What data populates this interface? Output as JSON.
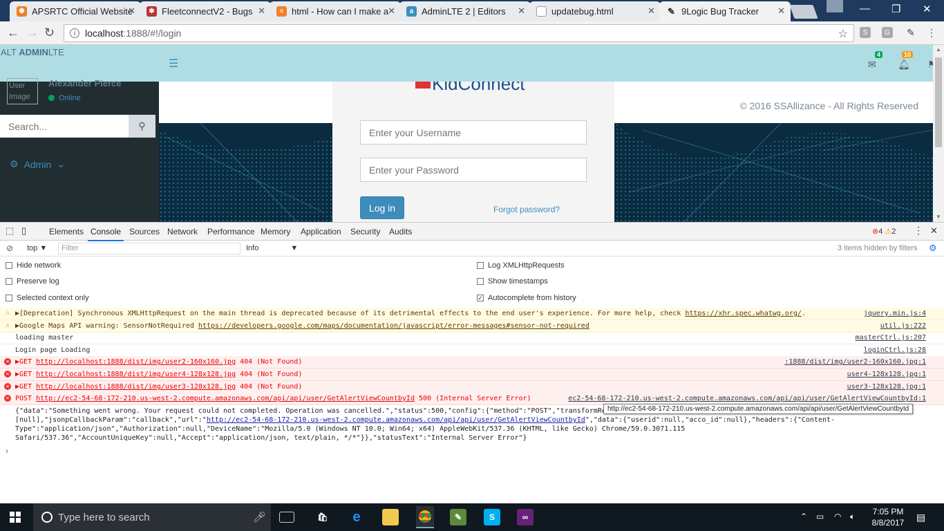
{
  "browser": {
    "tabs": [
      {
        "title": "APSRTC Official Website"
      },
      {
        "title": "FleetconnectV2 - Bugs"
      },
      {
        "title": "html - How can I make a"
      },
      {
        "title": "AdminLTE 2 | Editors"
      },
      {
        "title": "updatebug.html"
      },
      {
        "title": "9Logic Bug Tracker"
      }
    ],
    "url_host": "localhost",
    "url_path": ":1888/#!/login"
  },
  "app": {
    "brand_prefix": "ALT ",
    "brand_bold": "ADMIN",
    "brand_suffix": "LTE",
    "mail_badge": "4",
    "notif_badge": "10",
    "user_name": "Alexander Pierce",
    "user_status": "Online",
    "avatar_alt": "User Image",
    "search_placeholder": "Search...",
    "menu_admin": "Admin",
    "footer": "© 2016 SSAllizance - All Rights Reserved",
    "logo_text": "KidConnect",
    "username_placeholder": "Enter your Username",
    "password_placeholder": "Enter your Password",
    "login_button": "Log in",
    "forgot_link": "Forgot password?"
  },
  "devtools": {
    "tabs": [
      "Elements",
      "Console",
      "Sources",
      "Network",
      "Performance",
      "Memory",
      "Application",
      "Security",
      "Audits"
    ],
    "error_count": "4",
    "warning_count": "2",
    "context": "top",
    "filter_placeholder": "Filter",
    "level": "Info",
    "hidden_info": "3 items hidden by filters",
    "options_left": [
      "Hide network",
      "Preserve log",
      "Selected context only"
    ],
    "options_right": [
      "Log XMLHttpRequests",
      "Show timestamps",
      "Autocomplete from history"
    ],
    "logs": [
      {
        "type": "warn",
        "text_pre": "▶[Deprecation] Synchronous XMLHttpRequest on the main thread is deprecated because of its detrimental effects to the end user's experience. For more help, check ",
        "link": "https://xhr.spec.whatwg.org/",
        "text_post": ".",
        "source": "jquery.min.js:4"
      },
      {
        "type": "warn",
        "text_pre": "▶Google Maps API warning: SensorNotRequired ",
        "link": "https://developers.google.com/maps/documentation/javascript/error-messages#sensor-not-required",
        "text_post": "",
        "source": "util.js:222"
      },
      {
        "type": "info",
        "text_pre": "loading master",
        "link": "",
        "text_post": "",
        "source": "masterCtrl.js:207"
      },
      {
        "type": "info",
        "text_pre": "Login page Loading",
        "link": "",
        "text_post": "",
        "source": "loginCtrl.js:28"
      },
      {
        "type": "err",
        "text_pre": "▶GET ",
        "link": "http://localhost:1888/dist/img/user2-160x160.jpg",
        "text_post": " 404 (Not Found)",
        "source": ":1888/dist/img/user2-160x160.jpg:1"
      },
      {
        "type": "err",
        "text_pre": "▶GET ",
        "link": "http://localhost:1888/dist/img/user4-128x128.jpg",
        "text_post": " 404 (Not Found)",
        "source": "user4-128x128.jpg:1"
      },
      {
        "type": "err",
        "text_pre": "▶GET ",
        "link": "http://localhost:1888/dist/img/user3-128x128.jpg",
        "text_post": " 404 (Not Found)",
        "source": "user3-128x128.jpg:1"
      },
      {
        "type": "err",
        "text_pre": "POST ",
        "link": "http://ec2-54-68-172-210.us-west-2.compute.amazonaws.com/api/api/user/GetAlertViewCountbyId",
        "text_post": " 500 (Internal Server Error)",
        "source": "ec2-54-68-172-210.us-west-2.compute.amazonaws.com/api/api/user/GetAlertViewCountbyId:1"
      }
    ],
    "json_line1": "{\"data\":\"Something went wrong. Your request could not completed. Operation was cancelled.\",\"status\":500,\"config\":{\"method\":\"POST\",\"transformRequ",
    "json_line2_pre": "[null],\"jsonpCallbackParam\":\"callback\",\"url\":\"",
    "json_line2_link": "http://ec2-54-68-172-210.us-west-2.compute.amazonaws.com/api/api/user/GetAlertViewCountbyId",
    "json_line2_post": "\",\"data\":{\"userid\":null,\"acco_id\":null},\"headers\":{\"Content-",
    "json_line3": "Type\":\"application/json\",\"Authorization\":null,\"DeviceName\":\"Mozilla/5.0 (Windows NT 10.0; Win64; x64) AppleWebKit/537.36 (KHTML, like Gecko) Chrome/59.0.3071.115",
    "json_line4": "Safari/537.36\",\"AccountUniqueKey\":null,\"Accept\":\"application/json, text/plain, */*\"}},\"statusText\":\"Internal Server Error\"}",
    "tooltip": "http://ec2-54-68-172-210.us-west-2.compute.amazonaws.com/api/api/user/GetAlertViewCountbyId"
  },
  "taskbar": {
    "search_placeholder": "Type here to search",
    "time": "7:05 PM",
    "date": "8/8/2017"
  }
}
